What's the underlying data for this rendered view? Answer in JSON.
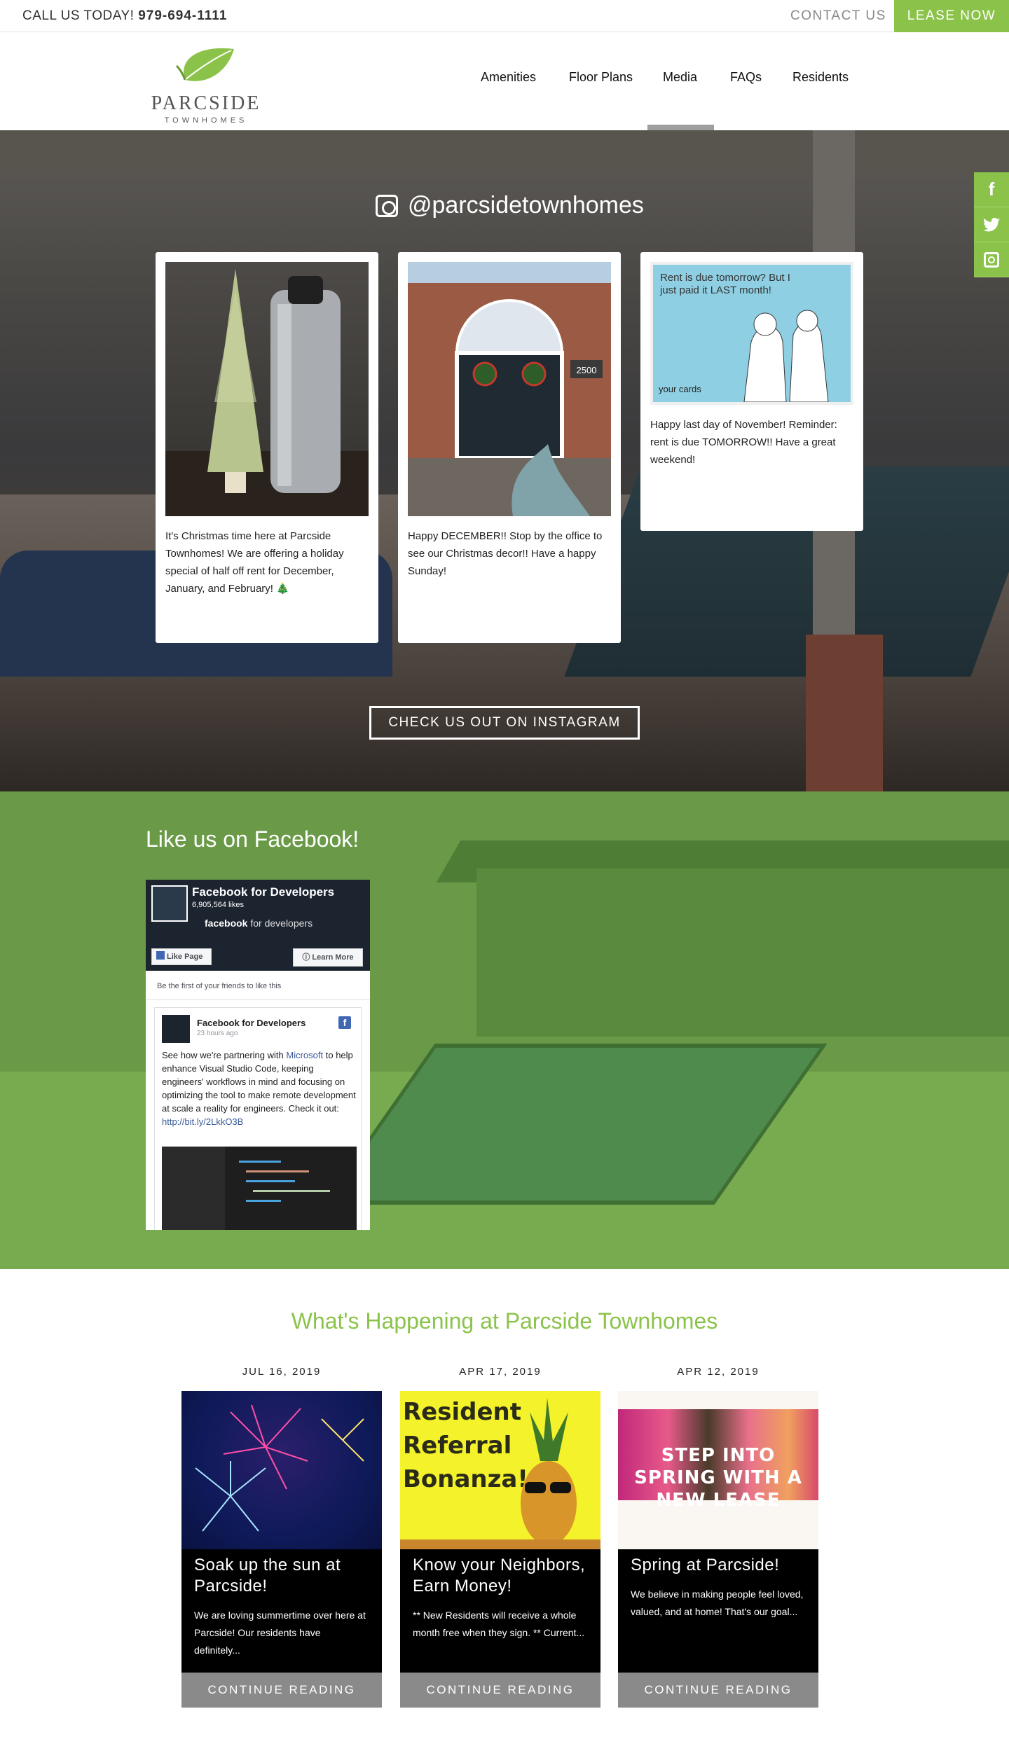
{
  "topbar": {
    "call_prefix": "CALL US TODAY!",
    "phone": "979-694-1111",
    "contact_label": "CONTACT US",
    "lease_label": "LEASE NOW"
  },
  "brand": {
    "name": "PARCSIDE",
    "sub": "TOWNHOMES",
    "accent": "#8bc34a"
  },
  "nav": {
    "items": [
      {
        "label": "Amenities"
      },
      {
        "label": "Floor Plans"
      },
      {
        "label": "Media",
        "active": true
      },
      {
        "label": "FAQs"
      },
      {
        "label": "Residents"
      }
    ]
  },
  "social": {
    "icons": [
      "facebook-icon",
      "twitter-icon",
      "instagram-icon"
    ],
    "glyphs": [
      "f",
      "t",
      "◘"
    ]
  },
  "instagram": {
    "handle": "@parcsidetownhomes",
    "posts": [
      {
        "caption": "It's Christmas time here at Parcside Townhomes! We are offering a holiday special of half off rent for December, January, and February! 🎄"
      },
      {
        "caption": "Happy DECEMBER!! Stop by the office to see our Christmas decor!! Have a happy Sunday!",
        "sign": "2500"
      },
      {
        "caption": "Happy last day of November! Reminder: rent is due TOMORROW!! Have a great weekend!",
        "ecard_text": "Rent is due tomorrow? But I just paid it LAST month!",
        "ecard_brand": "your cards"
      }
    ],
    "cta_label": "CHECK US OUT ON INSTAGRAM"
  },
  "facebook": {
    "heading": "Like us on Facebook!",
    "page_name": "Facebook for Developers",
    "likes": "6,905,564 likes",
    "brand_bold": "facebook",
    "brand_rest": "for developers",
    "like_page": "Like Page",
    "learn_more": "Learn More",
    "first_friends": "Be the first of your friends to like this",
    "post_title": "Facebook for Developers",
    "post_time": "23 hours ago",
    "post_text_1": "See how we're partnering with",
    "post_link_1": "Microsoft",
    "post_text_2": "to help enhance Visual Studio Code, keeping engineers' workflows in mind and focusing on optimizing the tool to make remote development at scale a reality for engineers. Check it out:",
    "post_link_2": "http://bit.ly/2LkkO3B"
  },
  "blog": {
    "title": "What's Happening at Parcside Townhomes",
    "posts": [
      {
        "date": "JUL 16, 2019",
        "title": "Soak up the sun at Parcside!",
        "excerpt": "We are loving summertime over here at Parcside! Our residents have definitely...",
        "more": "CONTINUE READING"
      },
      {
        "date": "APR 17, 2019",
        "title": "Know your Neighbors, Earn Money!",
        "excerpt": "** New Residents will receive a whole month free when they sign. ** Current...",
        "more": "CONTINUE READING",
        "image_text": "Resident Referral Bonanza!"
      },
      {
        "date": "APR 12, 2019",
        "title": "Spring at Parcside!",
        "excerpt": "We believe in making people feel loved, valued, and at home! That's our goal...",
        "more": "CONTINUE READING",
        "image_text": "STEP INTO SPRING WITH A NEW LEASE"
      }
    ]
  }
}
